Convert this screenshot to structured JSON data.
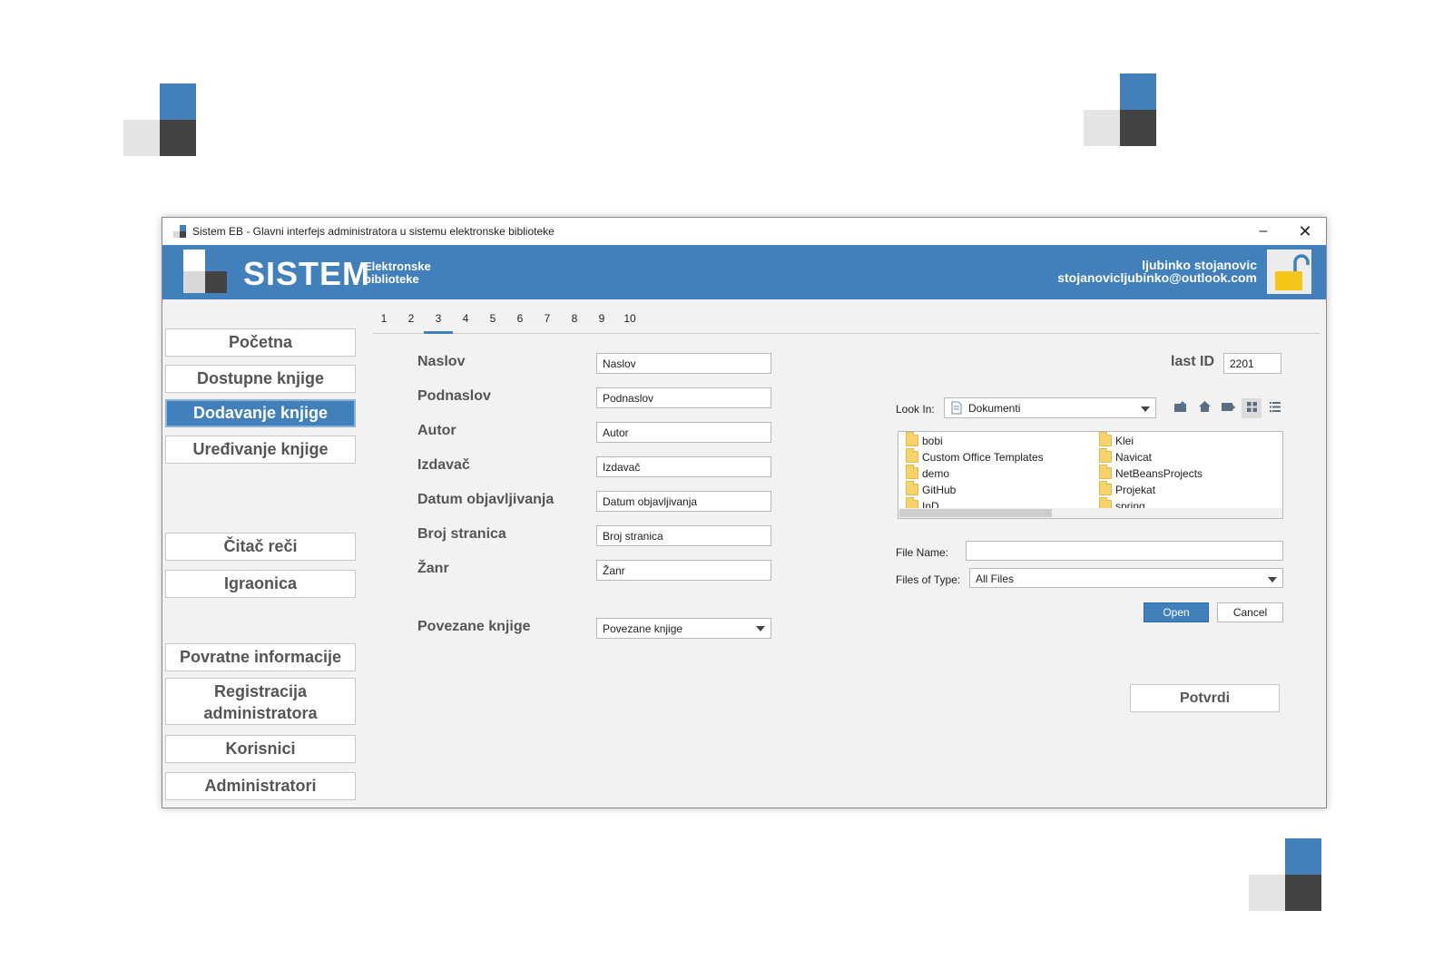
{
  "window": {
    "title": "Sistem EB - Glavni interfejs administratora u sistemu elektronske biblioteke",
    "minimize": "–",
    "close": "✕"
  },
  "header": {
    "brand": "SISTEM",
    "brand_sub_1": "Elektronske",
    "brand_sub_2": "biblioteke",
    "user_name": "ljubinko stojanovic",
    "user_email": "stojanovicljubinko@outlook.com"
  },
  "sidebar": {
    "items": [
      {
        "label": "Početna"
      },
      {
        "label": "Dostupne knjige"
      },
      {
        "label": "Dodavanje knjige",
        "active": true
      },
      {
        "label": "Uređivanje knjige"
      },
      {
        "label": "Čitač reči"
      },
      {
        "label": "Igraonica"
      },
      {
        "label": "Povratne informacije"
      },
      {
        "label": "Registracija administratora"
      },
      {
        "label": "Korisnici"
      },
      {
        "label": "Administratori"
      }
    ],
    "registracija_line1": "Registracija",
    "registracija_line2": "administratora"
  },
  "tabs": [
    "1",
    "2",
    "3",
    "4",
    "5",
    "6",
    "7",
    "8",
    "9",
    "10"
  ],
  "active_tab": "3",
  "form": {
    "fields": [
      {
        "label": "Naslov",
        "placeholder": "Naslov"
      },
      {
        "label": "Podnaslov",
        "placeholder": "Podnaslov"
      },
      {
        "label": "Autor",
        "placeholder": "Autor"
      },
      {
        "label": "Izdavač",
        "placeholder": "Izdavač"
      },
      {
        "label": "Datum objavljivanja",
        "placeholder": "Datum objavljivanja"
      },
      {
        "label": "Broj stranica",
        "placeholder": "Broj stranica"
      },
      {
        "label": "Žanr",
        "placeholder": "Žanr"
      }
    ],
    "related_label": "Povezane knjige",
    "related_value": "Povezane knjige",
    "last_id_label": "last ID",
    "last_id_value": "2201",
    "confirm_button": "Potvrdi"
  },
  "file_chooser": {
    "look_in_label": "Look In:",
    "look_in_value": "Dokumenti",
    "items_col1": [
      "bobi",
      "Custom Office Templates",
      "demo",
      "GitHub",
      "InD"
    ],
    "items_col2": [
      "Klei",
      "Navicat",
      "NetBeansProjects",
      "Projekat",
      "spring"
    ],
    "file_name_label": "File Name:",
    "file_name_value": "",
    "files_of_type_label": "Files of Type:",
    "files_of_type_value": "All Files",
    "open_button": "Open",
    "cancel_button": "Cancel",
    "toolbar_icons": [
      "up-folder-icon",
      "home-icon",
      "new-folder-icon",
      "list-view-icon",
      "details-view-icon"
    ]
  },
  "colors": {
    "accent": "#4180bb",
    "dark": "#434343",
    "light": "#e4e4e4",
    "lock": "#f5c518"
  }
}
